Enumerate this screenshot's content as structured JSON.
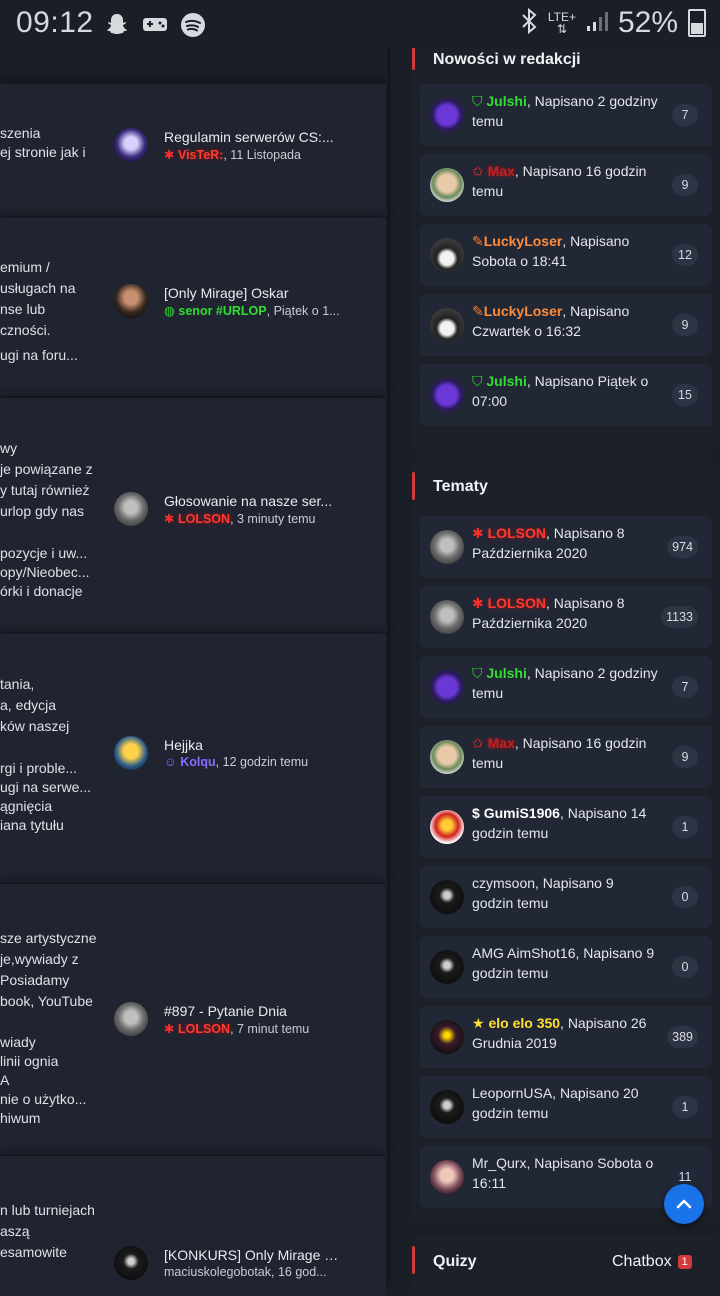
{
  "status_bar": {
    "time": "09:12",
    "icons": [
      "snapchat-icon",
      "gamepad-icon",
      "spotify-icon"
    ],
    "network": "LTE+",
    "battery": "52%"
  },
  "forums": [
    {
      "lines": [
        "szenia",
        "ej stronie jak i"
      ],
      "last_post": {
        "title": "Regulamin serwerów CS:...",
        "author": "VisTeR:",
        "when": ", 11 Listopada"
      }
    },
    {
      "lines": [
        "emium /",
        "usługach na",
        "nse lub",
        "czności.",
        "ugi na foru..."
      ],
      "last_post": {
        "title": "[Only Mirage] Oskar",
        "author": "senor #URLOP",
        "when": ", Piątek o 1..."
      }
    },
    {
      "lines": [
        "wy",
        "je powiązane z",
        "y tutaj również",
        "urlop gdy nas",
        "",
        "pozycje i uw...",
        "opy/Nieobec...",
        "órki i donacje"
      ],
      "last_post": {
        "title": "Głosowanie na nasze ser...",
        "author": "LOLSON",
        "when": ", 3 minuty temu"
      }
    },
    {
      "lines": [
        "tania,",
        "a, edycja",
        "ków naszej",
        "",
        "rgi i proble...",
        "ugi na serwe...",
        "ągnięcia",
        "iana tytułu"
      ],
      "last_post": {
        "title": "Hejjka",
        "author": "Kolqu",
        "when": ", 12 godzin temu"
      }
    },
    {
      "lines": [
        "sze artystyczne",
        "je,wywiady z",
        "Posiadamy",
        "book, YouTube",
        "",
        "wiady",
        "linii ognia",
        "A",
        "nie o użytko...",
        "hiwum"
      ],
      "last_post": {
        "title": "#897 - Pytanie Dnia",
        "author": "LOLSON",
        "when": ", 7 minut temu"
      }
    },
    {
      "lines": [
        "n lub turniejach",
        "aszą",
        "esamowite"
      ],
      "last_post": {
        "title": "[KONKURS] Only Mirage -...",
        "author": "",
        "when": "maciuskolegobotak, 16 god..."
      }
    }
  ],
  "nowosci": {
    "title": "Nowości w redakcji",
    "items": [
      {
        "name": "Julshi",
        "rest": ", Napisano 2 godziny temu",
        "count": "7"
      },
      {
        "name": "Max",
        "rest": ", Napisano 16 godzin temu",
        "count": "9"
      },
      {
        "name": "LuckyLoser",
        "rest": ", Napisano Sobota o 18:41",
        "count": "12"
      },
      {
        "name": "LuckyLoser",
        "rest": ", Napisano Czwartek o 16:32",
        "count": "9"
      },
      {
        "name": "Julshi",
        "rest": ", Napisano Piątek o 07:00",
        "count": "15"
      }
    ]
  },
  "tematy": {
    "title": "Tematy",
    "items": [
      {
        "name": "LOLSON",
        "rest": ", Napisano 8 Października 2020",
        "count": "974"
      },
      {
        "name": "LOLSON",
        "rest": ", Napisano 8 Października 2020",
        "count": "1133"
      },
      {
        "name": "Julshi",
        "rest": ", Napisano 2 godziny temu",
        "count": "7"
      },
      {
        "name": "Max",
        "rest": ", Napisano 16 godzin temu",
        "count": "9"
      },
      {
        "name": "GumiS1906",
        "rest": ", Napisano 14 godzin temu",
        "count": "1"
      },
      {
        "name": "czymsoon",
        "rest": ", Napisano 9 godzin temu",
        "count": "0"
      },
      {
        "name": "AMG AimShot16",
        "rest": ", Napisano 9 godzin temu",
        "count": "0"
      },
      {
        "name": "elo elo 350",
        "rest": ", Napisano 26 Grudnia 2019",
        "count": "389"
      },
      {
        "name": "LeopornUSA",
        "rest": ", Napisano 20 godzin temu",
        "count": "1"
      },
      {
        "name": "Mr_Qurx",
        "rest": ", Napisano Sobota o 16:11",
        "count": "11"
      }
    ]
  },
  "quizy": {
    "title": "Quizy"
  },
  "chatbox": {
    "label": "Chatbox",
    "badge": "1"
  },
  "colors": {
    "accent_red": "#d23a3a",
    "fab_blue": "#1a73e8",
    "background": "#1a1e27"
  }
}
